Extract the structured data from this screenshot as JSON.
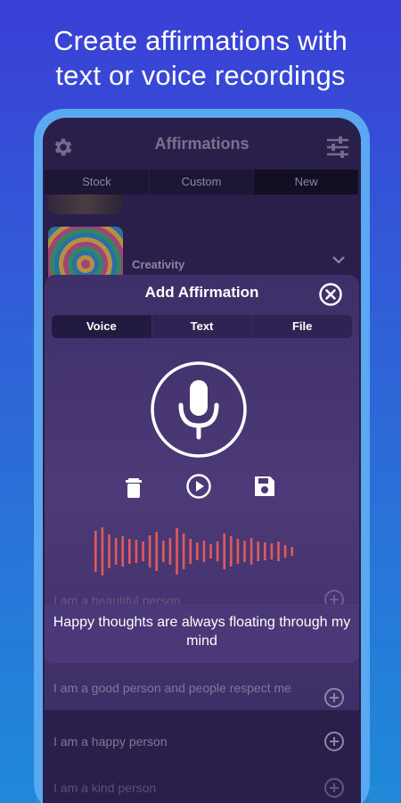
{
  "promo": {
    "headline_line1": "Create affirmations with",
    "headline_line2": "text or voice recordings"
  },
  "app": {
    "title": "Affirmations",
    "tabs": [
      "Stock",
      "Custom",
      "New"
    ],
    "active_tab": "New",
    "category": "Creativity"
  },
  "modal": {
    "title": "Add Affirmation",
    "segments": [
      "Voice",
      "Text",
      "File"
    ],
    "active_segment": "Voice",
    "waveform_color": "#e05a5a"
  },
  "list": {
    "rows": [
      "I am a beautiful person",
      "I am a good person and people respect me",
      "I am a happy person",
      "I am a kind person"
    ]
  },
  "toast": {
    "text": "Happy thoughts are always floating through my mind"
  },
  "colors": {
    "accent_blue": "#5aa7f2",
    "modal_bg": "#4d3a78",
    "screen_bg": "#2a1f4a"
  },
  "icons": {
    "settings": "gear-icon",
    "filters": "sliders-icon",
    "close": "close-circle-icon",
    "mic": "microphone-icon",
    "delete": "trash-icon",
    "play": "play-circle-icon",
    "save": "floppy-disk-icon",
    "add": "plus-circle-icon"
  }
}
